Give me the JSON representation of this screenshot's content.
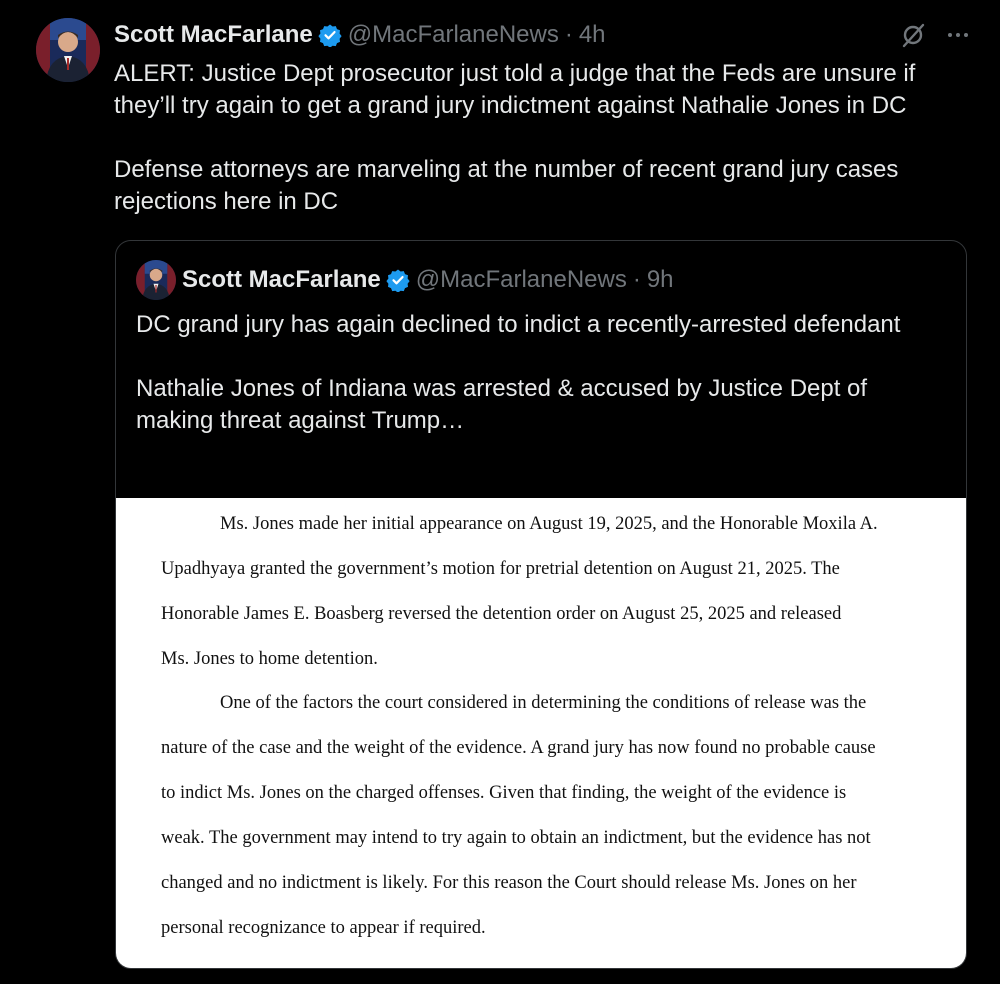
{
  "tweet": {
    "author_name": "Scott MacFarlane",
    "handle": "@MacFarlaneNews",
    "separator": "·",
    "time": "4h",
    "text": "ALERT:  Justice Dept prosecutor just told a judge that the Feds are unsure if they’ll try again to get a grand jury indictment against Nathalie Jones in DC\n\nDefense attorneys are marveling at the number of recent grand jury cases rejections here in DC",
    "icons": {
      "verified": "verified-badge-icon",
      "grok": "grok-icon",
      "more": "more-icon"
    },
    "colors": {
      "background": "#000000",
      "text": "#e7e9ea",
      "muted": "#71767b",
      "verified": "#1d9bf0",
      "border": "#333639"
    }
  },
  "quoted": {
    "author_name": "Scott MacFarlane",
    "handle": "@MacFarlaneNews",
    "separator": "·",
    "time": "9h",
    "text": "DC grand jury has again declined to indict a recently-arrested defendant\n\nNathalie Jones of Indiana was arrested & accused by Justice Dept of making threat against Trump…",
    "document_lines": [
      "Ms. Jones made her initial appearance on August 19, 2025, and the Honorable Moxila A.",
      "Upadhyaya granted the government’s motion for pretrial detention on August 21, 2025. The",
      "Honorable James E. Boasberg reversed the detention order on August 25, 2025 and released",
      "Ms. Jones to home detention.",
      "One of the factors the court considered in determining the conditions of release was the",
      "nature of the case and the weight of the evidence. A grand jury has now found no probable cause",
      "to indict Ms. Jones on the charged offenses. Given that finding, the weight of the evidence is",
      "weak. The government may intend to try again to obtain an indictment, but the evidence has not",
      "changed and no indictment is likely. For this reason the Court should release Ms. Jones on her",
      "personal recognizance to appear if required."
    ]
  }
}
